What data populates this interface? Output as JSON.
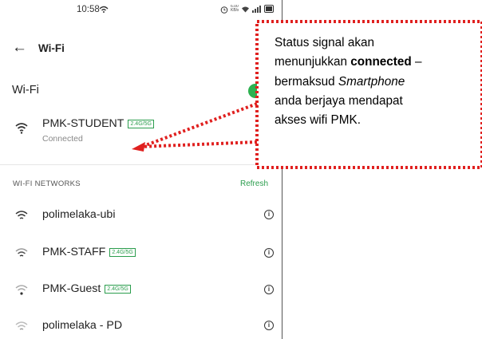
{
  "status_bar": {
    "time": "10:58",
    "net_speed": "6.00 KB/s",
    "icons": [
      "notification-icon",
      "alarm-icon",
      "wifi-icon",
      "signal-icon",
      "battery-icon"
    ]
  },
  "header": {
    "title": "Wi-Fi"
  },
  "wifi_toggle": {
    "label": "Wi-Fi",
    "on": true
  },
  "connected_network": {
    "name": "PMK-STUDENT",
    "badge": "2.4G/5G",
    "status": "Connected"
  },
  "networks_section": {
    "title": "WI-FI NETWORKS",
    "refresh": "Refresh"
  },
  "networks": [
    {
      "name": "polimelaka-ubi",
      "badge": ""
    },
    {
      "name": "PMK-STAFF",
      "badge": "2.4G/5G"
    },
    {
      "name": "PMK-Guest",
      "badge": "2.4G/5G"
    },
    {
      "name": "polimelaka - PD",
      "badge": ""
    }
  ],
  "callout": {
    "line1": "Status signal akan",
    "line2_pre": "menunjukkan ",
    "line2_bold": "connected",
    "line2_post": " –",
    "line3_pre": "bermaksud ",
    "line3_italic": "Smartphone",
    "line4": "anda berjaya mendapat",
    "line5": "akses wifi  PMK."
  },
  "colors": {
    "accent": "#2db150",
    "callout_border": "#e0201f"
  }
}
